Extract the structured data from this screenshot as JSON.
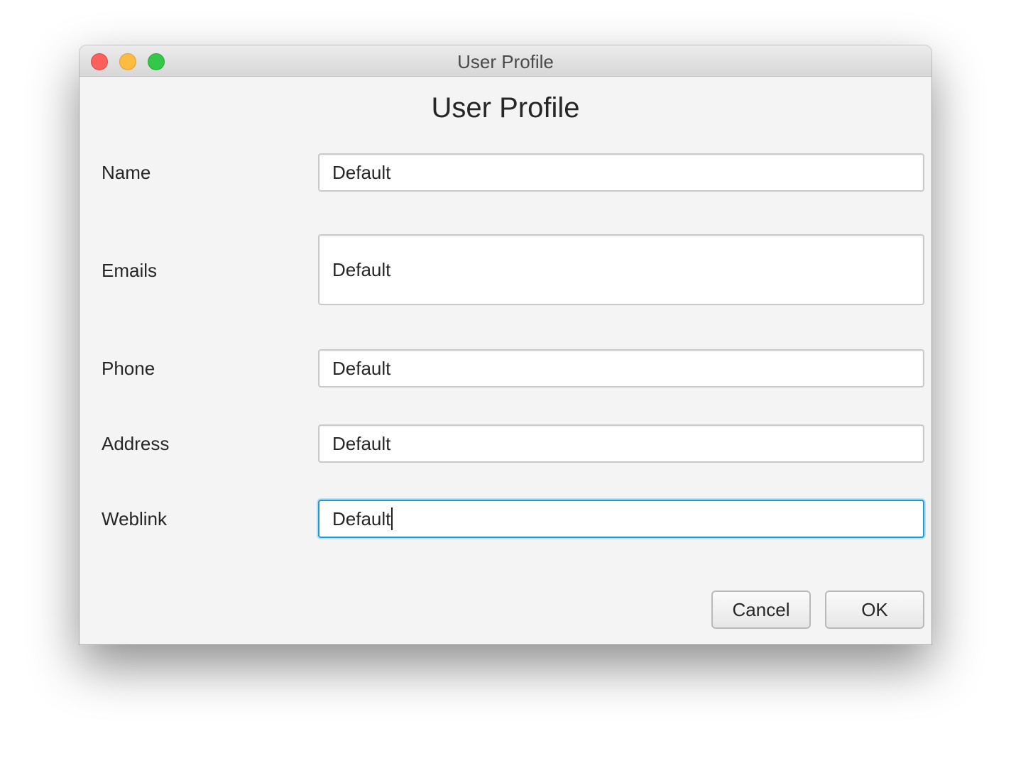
{
  "window": {
    "title": "User Profile"
  },
  "form": {
    "heading": "User Profile",
    "fields": [
      {
        "label": "Name",
        "value": "Default"
      },
      {
        "label": "Emails",
        "value": "Default"
      },
      {
        "label": "Phone",
        "value": "Default"
      },
      {
        "label": "Address",
        "value": "Default"
      },
      {
        "label": "Weblink",
        "value": "Default"
      }
    ],
    "focused_field": "Weblink"
  },
  "buttons": {
    "cancel": "Cancel",
    "ok": "OK"
  },
  "colors": {
    "close": "#fc605c",
    "minimize": "#fdbc40",
    "maximize": "#34c84a",
    "focus_ring": "#1a9bdb"
  }
}
